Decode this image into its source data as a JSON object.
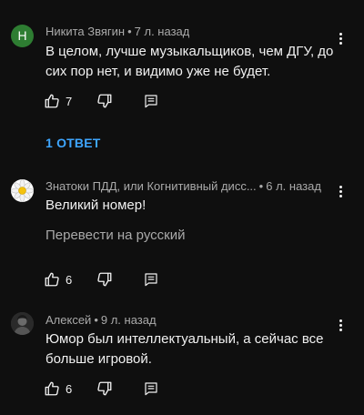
{
  "comments": [
    {
      "avatar_letter": "Н",
      "author": "Никита Звягин",
      "separator": "•",
      "time": "7 л. назад",
      "text": "В целом, лучше музыкальщиков, чем ДГУ, до сих пор нет, и видимо уже не будет.",
      "likes": "7",
      "replies_label": "1 ОТВЕТ",
      "avatar_color": "#2e7d32"
    },
    {
      "author": "Знатоки ПДД, или Когнитивный дисс...",
      "separator": "•",
      "time": "6 л. назад",
      "text": "Великий номер!",
      "translate_label": "Перевести на русский",
      "likes": "6",
      "avatar_icon": "daisy-avatar-icon"
    },
    {
      "author": "Алексей",
      "separator": "•",
      "time": "9 л. назад",
      "text": "Юмор был интеллектуальный, а сейчас все больше игровой.",
      "likes": "6",
      "avatar_icon": "photo-avatar-icon"
    }
  ],
  "colors": {
    "background": "#0f0f0f",
    "primary_text": "#f1f1f1",
    "secondary_text": "#aaaaaa",
    "link": "#3ea6ff"
  }
}
